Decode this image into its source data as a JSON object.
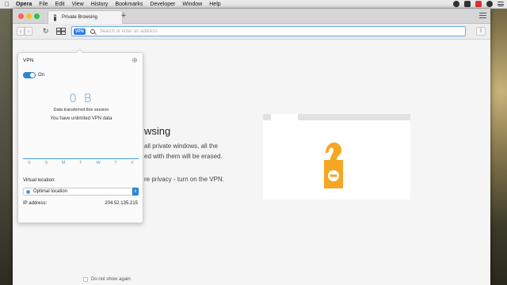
{
  "menubar": {
    "app": "Opera",
    "items": [
      "File",
      "Edit",
      "View",
      "History",
      "Bookmarks",
      "Developer",
      "Window",
      "Help"
    ]
  },
  "tab": {
    "title": "Private Browsing",
    "new_tab": "+"
  },
  "address": {
    "vpn_badge": "VPN",
    "placeholder": "Search or enter an address"
  },
  "vpn": {
    "title": "VPN",
    "toggle_label": "On",
    "data_value": "0 B",
    "data_label": "Data transferred this session",
    "unlimited": "You have unlimited VPN data",
    "days": [
      "S",
      "S",
      "M",
      "T",
      "W",
      "T",
      "F"
    ],
    "virtual_location_label": "Virtual location:",
    "location_value": "Optimal location",
    "ip_label": "IP address:",
    "ip_value": "204.52.135.215"
  },
  "page": {
    "heading": "wsing",
    "para1_lines": [
      "all private windows, all the",
      "ed with them will be erased."
    ],
    "para2": "re privacy - turn on the VPN.",
    "dont_show": "Do not show again"
  },
  "colors": {
    "accent": "#2a86d6",
    "vpn_blue": "#4a9ee0",
    "hanger": "#f5a623"
  }
}
